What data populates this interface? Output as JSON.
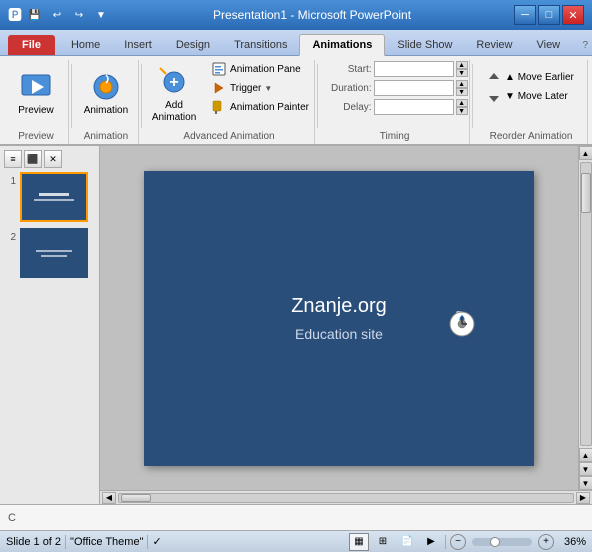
{
  "titlebar": {
    "title": "Presentation1 - Microsoft PowerPoint",
    "qat_buttons": [
      "save",
      "undo",
      "redo"
    ],
    "controls": [
      "minimize",
      "maximize",
      "close"
    ]
  },
  "ribbon": {
    "tabs": [
      {
        "id": "file",
        "label": "File",
        "type": "file"
      },
      {
        "id": "home",
        "label": "Home"
      },
      {
        "id": "insert",
        "label": "Insert"
      },
      {
        "id": "design",
        "label": "Design"
      },
      {
        "id": "transitions",
        "label": "Transitions"
      },
      {
        "id": "animations",
        "label": "Animations",
        "active": true
      },
      {
        "id": "slideshow",
        "label": "Slide Show"
      },
      {
        "id": "review",
        "label": "Review"
      },
      {
        "id": "view",
        "label": "View"
      }
    ],
    "groups": {
      "preview": {
        "label": "Preview",
        "buttons": [
          {
            "label": "Preview"
          }
        ]
      },
      "animation": {
        "label": "Animation",
        "buttons": [
          {
            "label": "Animation"
          }
        ]
      },
      "add_animation": {
        "label": "Advanced Animation",
        "buttons": [
          {
            "id": "add-animation",
            "label": "Add Animation"
          },
          {
            "id": "animation-pane",
            "label": "Animation Pane"
          },
          {
            "id": "trigger",
            "label": "Trigger"
          },
          {
            "id": "animation-painter",
            "label": "Animation Painter"
          }
        ]
      },
      "timing": {
        "label": "Timing",
        "fields": [
          {
            "id": "start",
            "label": "Start:",
            "value": ""
          },
          {
            "id": "duration",
            "label": "Duration:",
            "value": ""
          },
          {
            "id": "delay",
            "label": "Delay:",
            "value": ""
          }
        ]
      },
      "reorder": {
        "label": "Reorder Animation",
        "buttons": [
          {
            "id": "move-earlier",
            "label": "▲ Move Earlier"
          },
          {
            "id": "move-later",
            "label": "▼ Move Later"
          }
        ]
      }
    }
  },
  "slides": [
    {
      "num": "1",
      "selected": true
    },
    {
      "num": "2",
      "selected": false
    }
  ],
  "slide_content": {
    "title": "Znanje.org",
    "subtitle": "Education site"
  },
  "statusbar": {
    "slide_info": "Slide 1 of 2",
    "theme": "\"Office Theme\"",
    "zoom": "36%"
  },
  "notes": {
    "placeholder": "C"
  }
}
